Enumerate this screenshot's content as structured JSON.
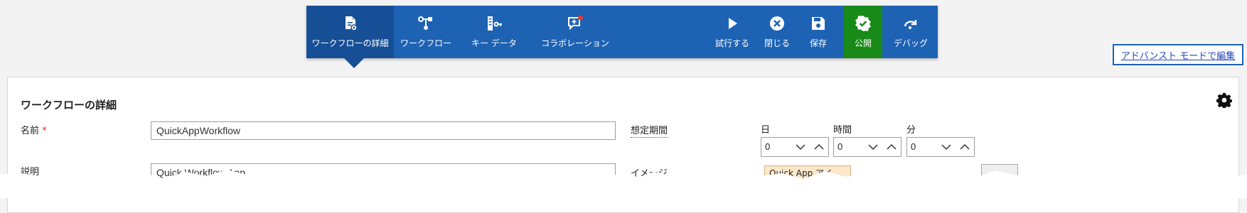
{
  "toolbar": {
    "items": [
      {
        "label": "ワークフローの詳細",
        "icon": "workflow-details-icon"
      },
      {
        "label": "ワークフロー",
        "icon": "workflow-icon"
      },
      {
        "label": "キー データ",
        "icon": "key-data-icon"
      },
      {
        "label": "コラボレーション",
        "icon": "collaboration-icon",
        "badge": true
      },
      {
        "label": "試行する",
        "icon": "play-icon"
      },
      {
        "label": "閉じる",
        "icon": "close-icon"
      },
      {
        "label": "保存",
        "icon": "save-icon"
      },
      {
        "label": "公開",
        "icon": "publish-icon"
      },
      {
        "label": "デバッグ",
        "icon": "debug-icon"
      }
    ],
    "active_index": 0
  },
  "advanced_link": "アドバンスト モードで編集",
  "panel": {
    "title": "ワークフローの詳細",
    "name_label": "名前",
    "name_required": "*",
    "name_value": "QuickAppWorkflow",
    "description_label": "説明",
    "description_value": "Quick Workflow App",
    "duration_label": "想定期間",
    "days_label": "日",
    "hours_label": "時間",
    "minutes_label": "分",
    "days_value": "0",
    "hours_value": "0",
    "minutes_value": "0",
    "image_label": "イメージ",
    "image_value": "Quick App アイ"
  },
  "colors": {
    "toolbar": "#1e62b4",
    "toolbar_active": "#174f97",
    "publish": "#178a17",
    "badge": "#e53935",
    "link": "#2246b8"
  }
}
